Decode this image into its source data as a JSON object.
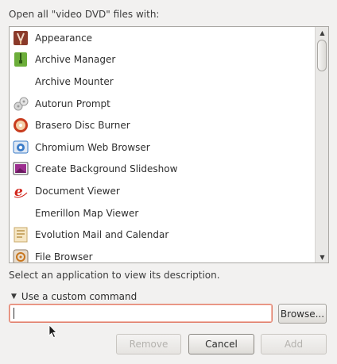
{
  "header": {
    "label": "Open all \"video DVD\" files with:"
  },
  "apps": [
    {
      "name": "Appearance",
      "icon": "appearance-icon",
      "color": "#8b3a2a"
    },
    {
      "name": "Archive Manager",
      "icon": "archive-manager-icon",
      "color": "#6cae3a"
    },
    {
      "name": "Archive Mounter",
      "icon": "none",
      "color": ""
    },
    {
      "name": "Autorun Prompt",
      "icon": "autorun-prompt-icon",
      "color": "#9b9b9b"
    },
    {
      "name": "Brasero Disc Burner",
      "icon": "brasero-icon",
      "color": "#c83c1e"
    },
    {
      "name": "Chromium Web Browser",
      "icon": "chromium-icon",
      "color": "#3a7bc8"
    },
    {
      "name": "Create Background Slideshow",
      "icon": "slideshow-icon",
      "color": "#9c2f8f"
    },
    {
      "name": "Document Viewer",
      "icon": "document-viewer-icon",
      "color": "#d2261c"
    },
    {
      "name": "Emerillon Map Viewer",
      "icon": "none",
      "color": ""
    },
    {
      "name": "Evolution Mail and Calendar",
      "icon": "evolution-icon",
      "color": "#c9a96a"
    },
    {
      "name": "File Browser",
      "icon": "file-browser-icon",
      "color": "#c8761e"
    }
  ],
  "description": {
    "text": "Select an application to view its description."
  },
  "custom_command": {
    "expander_label": "Use a custom command",
    "value": "",
    "placeholder": ""
  },
  "buttons": {
    "browse": "Browse...",
    "remove": "Remove",
    "cancel": "Cancel",
    "add": "Add"
  }
}
